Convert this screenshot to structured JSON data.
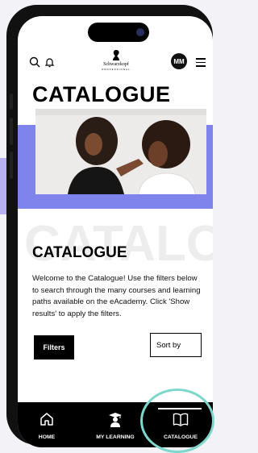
{
  "header": {
    "brand_name": "Schwarzkopf",
    "brand_sub": "PROFESSIONAL",
    "avatar_initials": "MM"
  },
  "page_title": "CATALOGUE",
  "hero": {
    "watermark": "CATALOGUE"
  },
  "intro": {
    "title": "CATALOGUE",
    "description": "Welcome to the Catalogue! Use the filters below to search through the many courses and learning paths available on the eAcademy. Click 'Show results' to apply the filters."
  },
  "controls": {
    "filters_label": "Filters",
    "sort_label": "Sort by"
  },
  "tabbar": {
    "tabs": [
      {
        "label": "HOME",
        "icon": "home-icon"
      },
      {
        "label": "MY LEARNING",
        "icon": "graduate-icon"
      },
      {
        "label": "CATALOGUE",
        "icon": "book-icon"
      }
    ],
    "active": "CATALOGUE"
  },
  "colors": {
    "accent_band": "#7f84ec",
    "highlight_ring": "#7ed7cc"
  }
}
